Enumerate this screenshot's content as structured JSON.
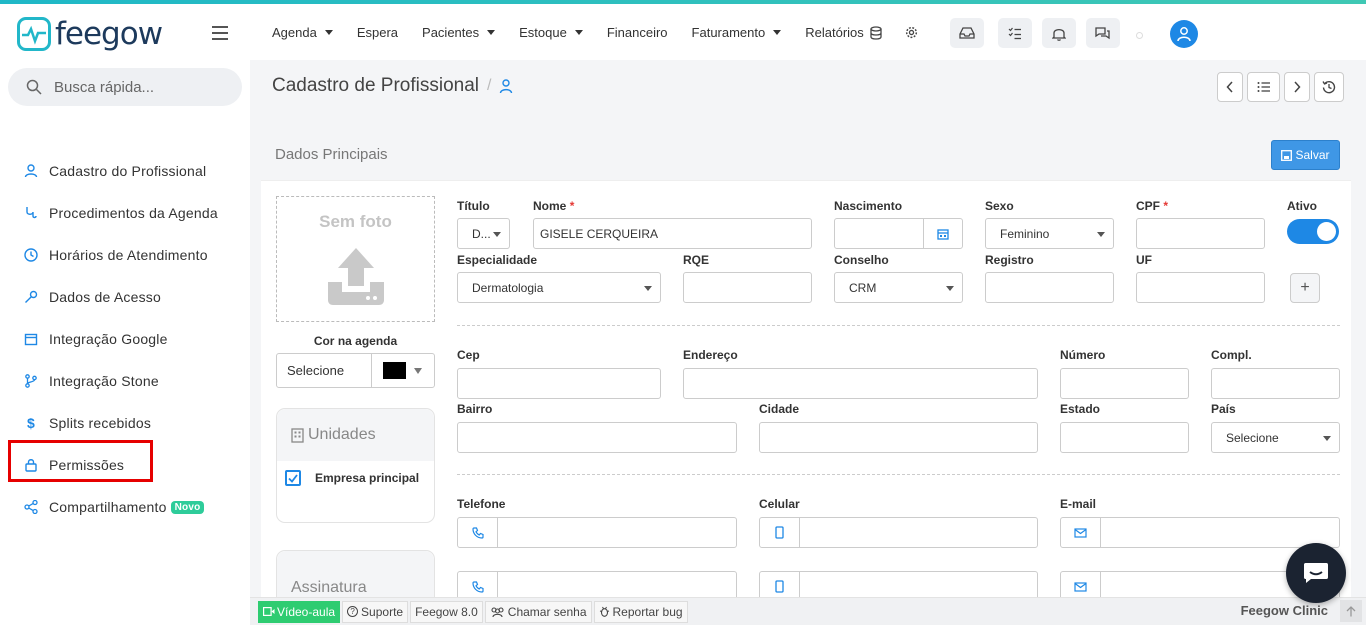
{
  "brand": {
    "name": "feegow",
    "accent": "#22b7c9",
    "primary": "#1e88e5"
  },
  "search": {
    "placeholder": "Busca rápida..."
  },
  "sidebar": {
    "items": [
      {
        "label": "Cadastro do Profissional",
        "icon": "user-doctor-icon"
      },
      {
        "label": "Procedimentos da Agenda",
        "icon": "stethoscope-icon"
      },
      {
        "label": "Horários de Atendimento",
        "icon": "clock-icon"
      },
      {
        "label": "Dados de Acesso",
        "icon": "key-icon"
      },
      {
        "label": "Integração Google",
        "icon": "calendar-icon"
      },
      {
        "label": "Integração Stone",
        "icon": "branch-icon"
      },
      {
        "label": "Splits recebidos",
        "icon": "dollar-icon"
      },
      {
        "label": "Permissões",
        "icon": "lock-icon"
      },
      {
        "label": "Compartilhamento",
        "icon": "share-icon",
        "badge": "Novo"
      }
    ]
  },
  "topmenu": {
    "agenda": "Agenda",
    "espera": "Espera",
    "pacientes": "Pacientes",
    "estoque": "Estoque",
    "financeiro": "Financeiro",
    "faturamento": "Faturamento",
    "relatorios": "Relatórios"
  },
  "page": {
    "title": "Cadastro de Profissional",
    "sep": "/"
  },
  "panel": {
    "title": "Dados Principais",
    "save_label": "Salvar"
  },
  "photo": {
    "label": "Sem foto"
  },
  "cor": {
    "label": "Cor na agenda",
    "value": "Selecione",
    "color": "#000000"
  },
  "unidades": {
    "title": "Unidades",
    "item": "Empresa principal"
  },
  "assinatura": {
    "title": "Assinatura"
  },
  "form": {
    "titulo": {
      "label": "Título",
      "value": "D..."
    },
    "nome": {
      "label": "Nome",
      "value": "GISELE CERQUEIRA",
      "req": "*"
    },
    "nascimento": {
      "label": "Nascimento",
      "value": ""
    },
    "sexo": {
      "label": "Sexo",
      "value": "Feminino"
    },
    "cpf": {
      "label": "CPF",
      "value": "",
      "req": "*"
    },
    "ativo": {
      "label": "Ativo",
      "on": true
    },
    "especialidade": {
      "label": "Especialidade",
      "value": "Dermatologia"
    },
    "rqe": {
      "label": "RQE",
      "value": ""
    },
    "conselho": {
      "label": "Conselho",
      "value": "CRM"
    },
    "registro": {
      "label": "Registro",
      "value": ""
    },
    "uf": {
      "label": "UF",
      "value": ""
    },
    "plus": "+",
    "cep": {
      "label": "Cep"
    },
    "endereco": {
      "label": "Endereço"
    },
    "numero": {
      "label": "Número"
    },
    "compl": {
      "label": "Compl."
    },
    "bairro": {
      "label": "Bairro"
    },
    "cidade": {
      "label": "Cidade"
    },
    "estado": {
      "label": "Estado"
    },
    "pais": {
      "label": "País",
      "value": "Selecione"
    },
    "telefone": {
      "label": "Telefone"
    },
    "celular": {
      "label": "Celular"
    },
    "email": {
      "label": "E-mail"
    }
  },
  "footer": {
    "video": "Vídeo-aula",
    "suporte": "Suporte",
    "version": "Feegow 8.0",
    "chamar": "Chamar senha",
    "reportar": "Reportar bug",
    "clinic": "Feegow Clinic"
  }
}
